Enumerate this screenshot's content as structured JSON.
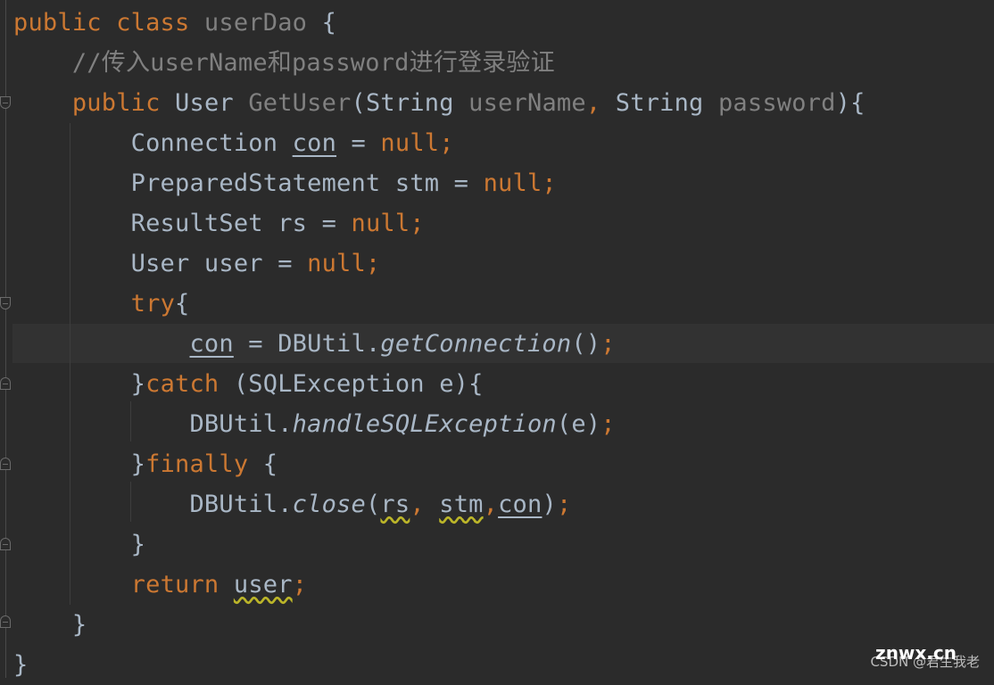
{
  "editor": {
    "colors": {
      "background": "#2b2b2b",
      "keyword": "#cc7832",
      "text": "#a9b7c6",
      "comment": "#808080",
      "current_line": "#323232"
    },
    "current_line_index": 8,
    "lines": [
      [
        [
          "public class ",
          "kw"
        ],
        [
          "userDao",
          "gr"
        ],
        [
          " {",
          "tx"
        ]
      ],
      [
        [
          "    ",
          "tx"
        ],
        [
          "//传入userName和password进行登录验证",
          "cm"
        ]
      ],
      [
        [
          "    ",
          "tx"
        ],
        [
          "public ",
          "kw"
        ],
        [
          "User ",
          "tx"
        ],
        [
          "GetUser",
          "gr"
        ],
        [
          "(String ",
          "tx"
        ],
        [
          "userName",
          "gr"
        ],
        [
          ", ",
          "kw"
        ],
        [
          "String ",
          "tx"
        ],
        [
          "password",
          "gr"
        ],
        [
          "){",
          "tx"
        ]
      ],
      [
        [
          "        Connection ",
          "tx"
        ],
        [
          "con",
          "ul"
        ],
        [
          " = ",
          "tx"
        ],
        [
          "null;",
          "kw"
        ]
      ],
      [
        [
          "        PreparedStatement stm = ",
          "tx"
        ],
        [
          "null;",
          "kw"
        ]
      ],
      [
        [
          "        ResultSet rs = ",
          "tx"
        ],
        [
          "null;",
          "kw"
        ]
      ],
      [
        [
          "        User user = ",
          "tx"
        ],
        [
          "null;",
          "kw"
        ]
      ],
      [
        [
          "        ",
          "tx"
        ],
        [
          "try",
          "kw"
        ],
        [
          "{",
          "tx"
        ]
      ],
      [
        [
          "            ",
          "tx"
        ],
        [
          "con",
          "ul"
        ],
        [
          " = DBUtil.",
          "tx"
        ],
        [
          "getConnection",
          "it"
        ],
        [
          "()",
          "tx"
        ],
        [
          ";",
          "kw"
        ]
      ],
      [
        [
          "        }",
          "tx"
        ],
        [
          "catch ",
          "kw"
        ],
        [
          "(SQLException e){",
          "tx"
        ]
      ],
      [
        [
          "            DBUtil.",
          "tx"
        ],
        [
          "handleSQLException",
          "it"
        ],
        [
          "(e)",
          "tx"
        ],
        [
          ";",
          "kw"
        ]
      ],
      [
        [
          "        }",
          "tx"
        ],
        [
          "finally ",
          "kw"
        ],
        [
          "{",
          "tx"
        ]
      ],
      [
        [
          "            DBUtil.",
          "tx"
        ],
        [
          "close",
          "it"
        ],
        [
          "(",
          "tx"
        ],
        [
          "rs",
          "wv"
        ],
        [
          ", ",
          "kw"
        ],
        [
          "stm",
          "wv"
        ],
        [
          ",",
          "kw"
        ],
        [
          "con",
          "ul"
        ],
        [
          ")",
          "tx"
        ],
        [
          ";",
          "kw"
        ]
      ],
      [
        [
          "        }",
          "tx"
        ]
      ],
      [
        [
          "        ",
          "tx"
        ],
        [
          "return ",
          "kw"
        ],
        [
          "user",
          "wvu"
        ],
        [
          ";",
          "kw"
        ]
      ],
      [
        [
          "    }",
          "tx"
        ]
      ],
      [
        [
          "}",
          "tx"
        ]
      ]
    ]
  },
  "watermark": {
    "csdn": "CSDN @君生我老",
    "site": "znwx.cn"
  }
}
